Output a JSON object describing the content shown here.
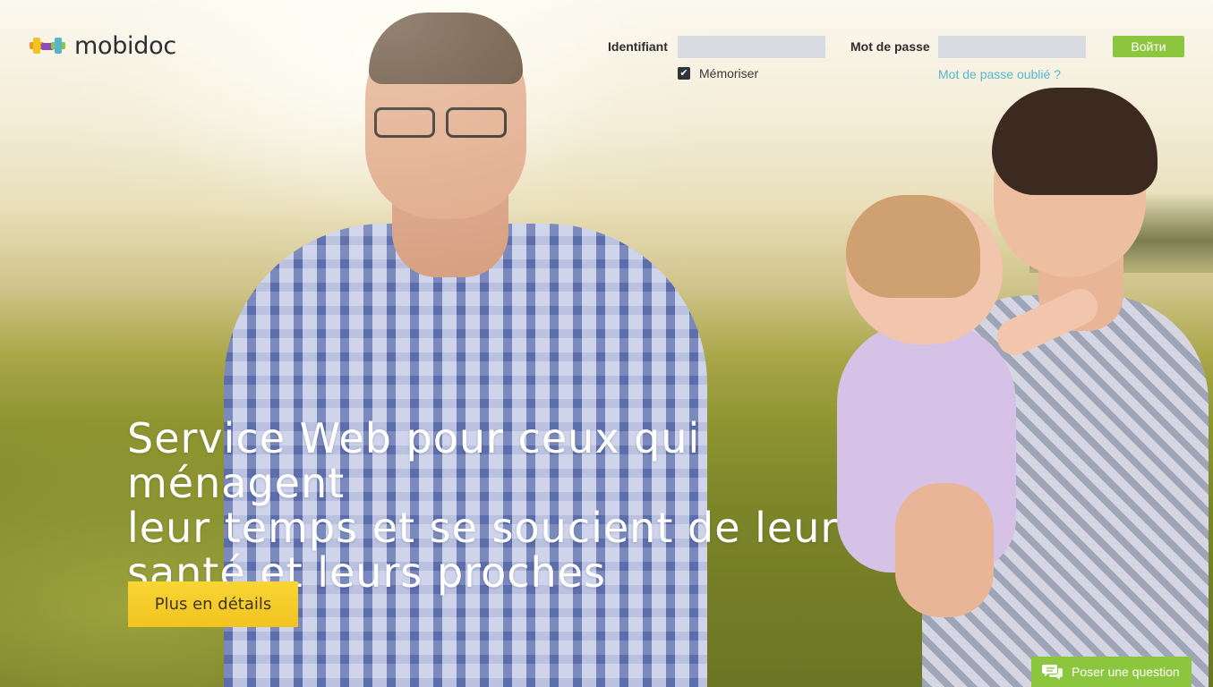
{
  "brand": {
    "name": "mobidoc",
    "colors": {
      "green": "#8cc63f",
      "yellow": "#f2c41f",
      "blue": "#57b6cf",
      "purple": "#8a4fb0",
      "orange": "#f7941d"
    }
  },
  "login": {
    "username_label": "Identifiant",
    "username_value": "",
    "password_label": "Mot de passe",
    "password_value": "",
    "submit_label": "Войти",
    "remember_label": "Mémoriser",
    "remember_checked": true,
    "forgot_label": "Mot de passe oublié ?"
  },
  "hero": {
    "title_lines": [
      "Service Web pour ceux qui ménagent",
      "leur temps et se soucient de leur",
      "santé et leurs proches"
    ],
    "cta_label": "Plus en détails"
  },
  "support": {
    "label": "Poser une question",
    "icon": "chat-bubbles-icon"
  }
}
